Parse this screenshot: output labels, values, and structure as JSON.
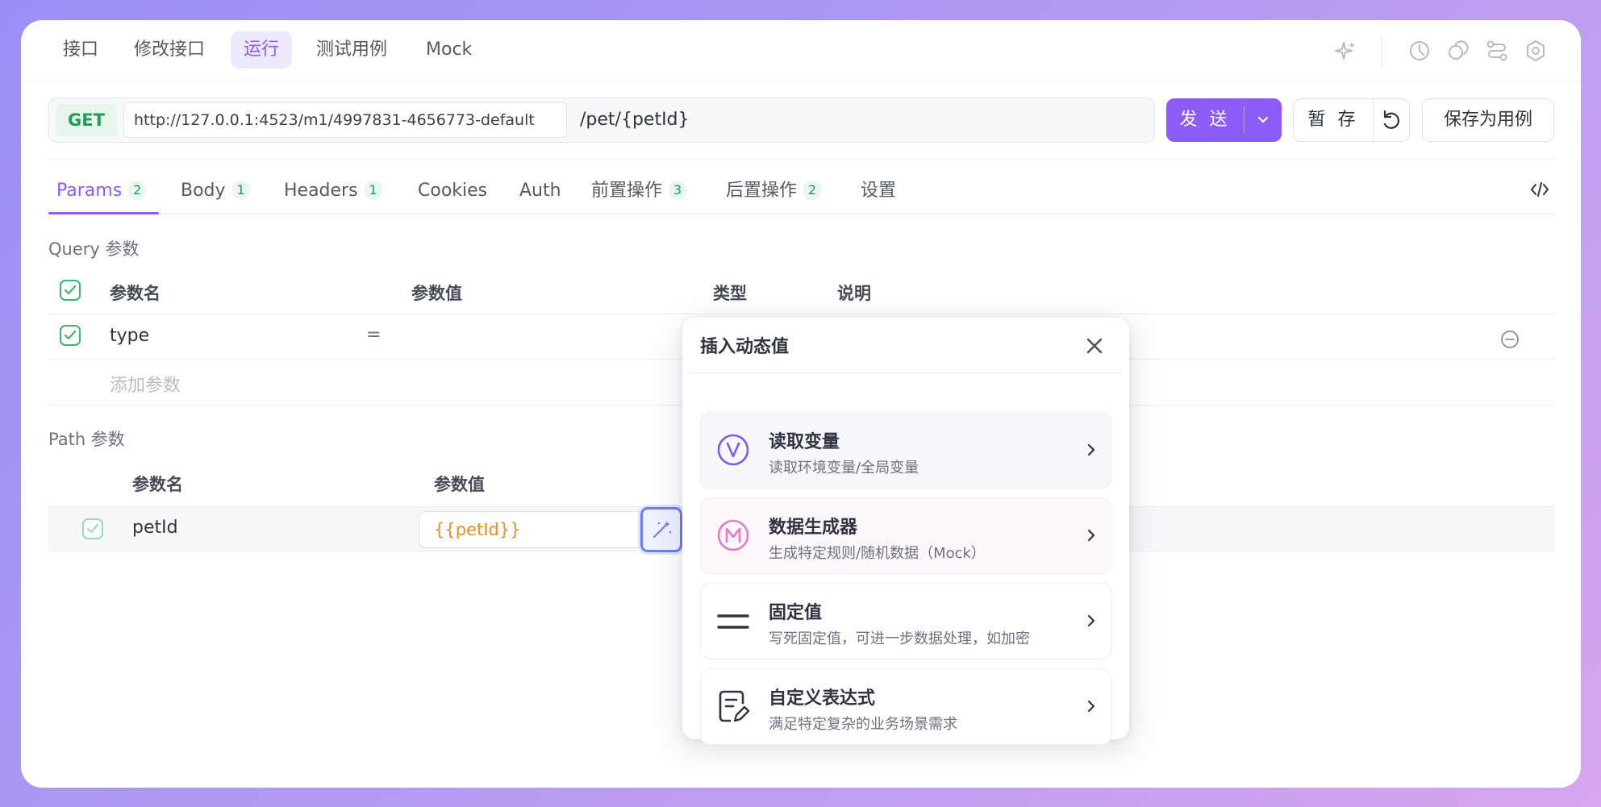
{
  "top_tabs": [
    {
      "label": "接口"
    },
    {
      "label": "修改接口"
    },
    {
      "label": "运行"
    },
    {
      "label": "测试用例"
    },
    {
      "label": "Mock"
    }
  ],
  "request": {
    "method": "GET",
    "base_url": "http://127.0.0.1:4523/m1/4997831-4656773-default",
    "path": "/pet/{petId}",
    "send_label": "发 送",
    "save_label": "暂 存",
    "save_case_label": "保存为用例"
  },
  "sub_tabs": [
    {
      "label": "Params",
      "count": "2"
    },
    {
      "label": "Body",
      "count": "1"
    },
    {
      "label": "Headers",
      "count": "1"
    },
    {
      "label": "Cookies",
      "count": ""
    },
    {
      "label": "Auth",
      "count": ""
    },
    {
      "label": "前置操作",
      "count": "3"
    },
    {
      "label": "后置操作",
      "count": "2"
    },
    {
      "label": "设置",
      "count": ""
    }
  ],
  "query": {
    "section_label": "Query 参数",
    "headers": {
      "name": "参数名",
      "value": "参数值",
      "type": "类型",
      "desc": "说明"
    },
    "rows": [
      {
        "name": "type",
        "eq": "="
      }
    ],
    "add_placeholder": "添加参数"
  },
  "path_params": {
    "section_label": "Path 参数",
    "headers": {
      "name": "参数名",
      "value": "参数值"
    },
    "rows": [
      {
        "name": "petId",
        "value": "{{petId}}"
      }
    ]
  },
  "popover": {
    "title": "插入动态值",
    "options": [
      {
        "title": "读取变量",
        "desc": "读取环境变量/全局变量",
        "icon": "variable-icon",
        "bg": "#f7f7fc"
      },
      {
        "title": "数据生成器",
        "desc": "生成特定规则/随机数据（Mock）",
        "icon": "mock-icon",
        "bg": "#fdf7fc"
      },
      {
        "title": "固定值",
        "desc": "写死固定值，可进一步数据处理，如加密",
        "icon": "equals-icon",
        "bg": "#ffffff"
      },
      {
        "title": "自定义表达式",
        "desc": "满足特定复杂的业务场景需求",
        "icon": "expression-icon",
        "bg": "#ffffff"
      }
    ]
  },
  "colors": {
    "accent": "#8b5cf6",
    "success": "#3cb371",
    "mock_pink": "#e879c8",
    "variable_purple": "#7c5cf0"
  }
}
